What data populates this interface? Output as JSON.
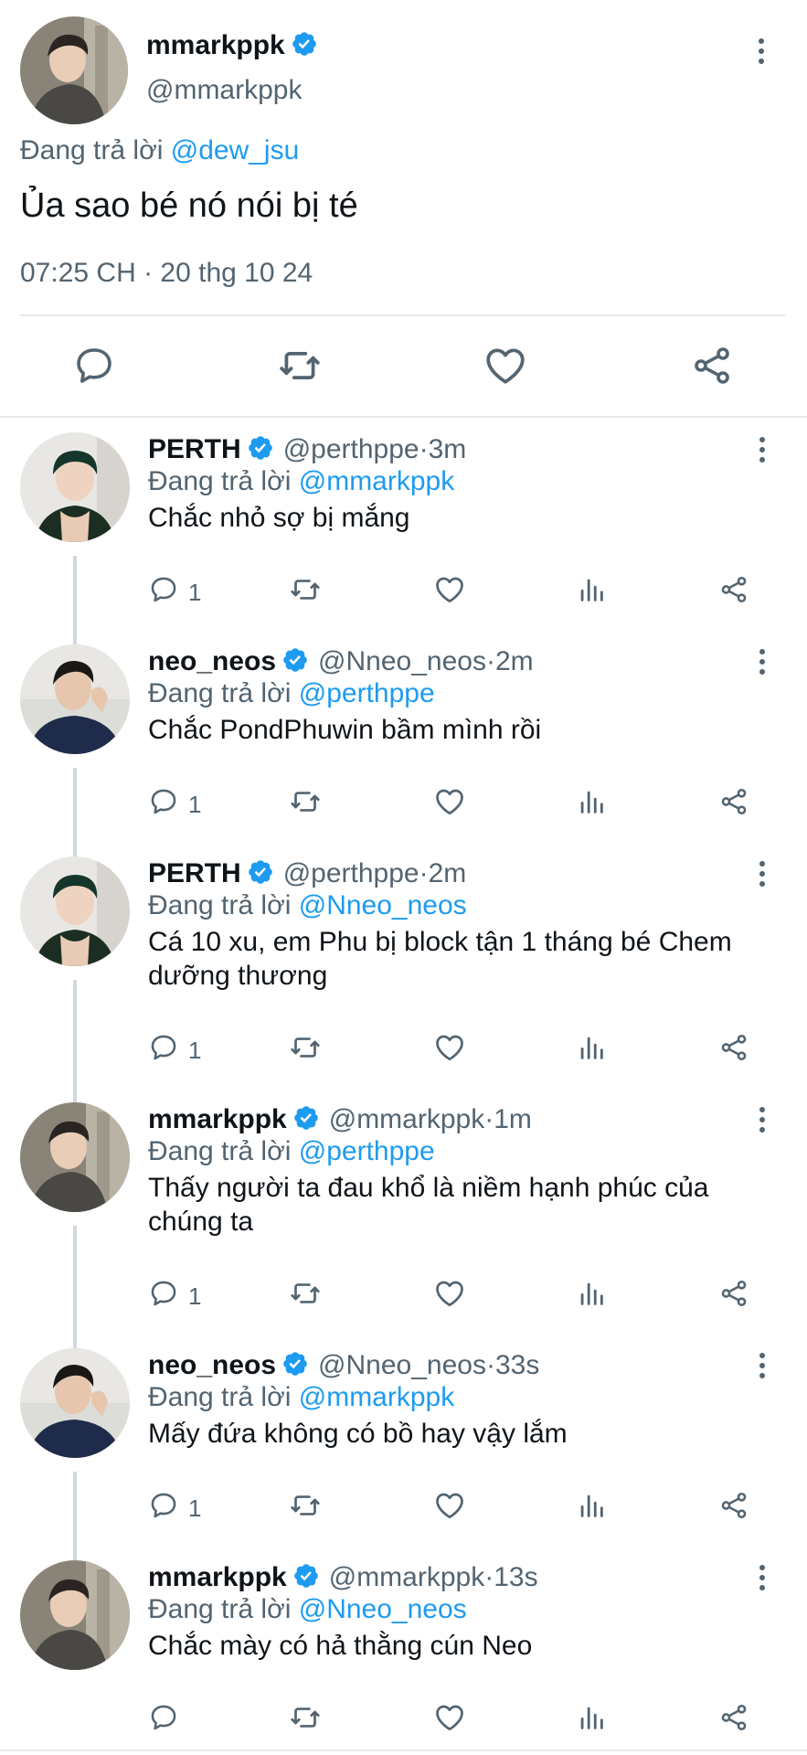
{
  "main_tweet": {
    "display_name": "mmarkppk",
    "handle": "@mmarkppk",
    "replying_prefix": "Đang trả lời ",
    "replying_to": "@dew_jsu",
    "text": "Ủa sao bé nó nói bị té",
    "timestamp": "07:25 CH · 20 thg 10 24"
  },
  "replies": [
    {
      "name": "PERTH",
      "handle": "@perthppe",
      "time": "3m",
      "replying_prefix": "Đang trả lời ",
      "replying_to": "@mmarkppk",
      "text": "Chắc nhỏ sợ bị mắng",
      "reply_count": "1"
    },
    {
      "name": "neo_neos",
      "handle": "@Nneo_neos",
      "time": "2m",
      "replying_prefix": "Đang trả lời ",
      "replying_to": "@perthppe",
      "text": "Chắc PondPhuwin bầm mình rồi",
      "reply_count": "1"
    },
    {
      "name": "PERTH",
      "handle": "@perthppe",
      "time": "2m",
      "replying_prefix": "Đang trả lời ",
      "replying_to": "@Nneo_neos",
      "text": "Cá 10 xu, em Phu bị block tận 1 tháng bé Chem dưỡng thương",
      "reply_count": "1"
    },
    {
      "name": "mmarkppk",
      "handle": "@mmarkppk",
      "time": "1m",
      "replying_prefix": "Đang trả lời ",
      "replying_to": "@perthppe",
      "text": "Thấy người ta đau khổ là niềm hạnh phúc của chúng ta",
      "reply_count": "1"
    },
    {
      "name": "neo_neos",
      "handle": "@Nneo_neos",
      "time": "33s",
      "replying_prefix": "Đang trả lời ",
      "replying_to": "@mmarkppk",
      "text": "Mấy đứa không có bồ hay vậy lắm",
      "reply_count": "1"
    },
    {
      "name": "mmarkppk",
      "handle": "@mmarkppk",
      "time": "13s",
      "replying_prefix": "Đang trả lời ",
      "replying_to": "@Nneo_neos",
      "text": "Chắc mày có hả thằng cún Neo",
      "reply_count": ""
    }
  ],
  "meta_separator": " · ",
  "icons": {
    "reply": "reply-icon",
    "retweet": "retweet-icon",
    "like": "like-icon",
    "analytics": "analytics-icon",
    "share": "share-icon",
    "verified": "verified-badge-icon",
    "more": "more-options-icon"
  },
  "colors": {
    "link": "#1d9bf0",
    "verified": "#1d9bf0",
    "secondary_text": "#536471",
    "primary_text": "#0f1419",
    "divider": "#e7e9ea"
  }
}
